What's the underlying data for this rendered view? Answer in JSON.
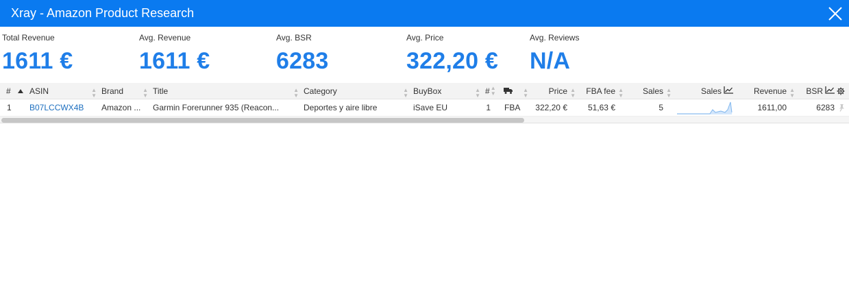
{
  "window": {
    "title": "Xray - Amazon Product Research"
  },
  "stats": [
    {
      "label": "Total Revenue",
      "value": "1611 €"
    },
    {
      "label": "Avg. Revenue",
      "value": "1611 €"
    },
    {
      "label": "Avg. BSR",
      "value": "6283"
    },
    {
      "label": "Avg. Price",
      "value": "322,20 €"
    },
    {
      "label": "Avg. Reviews",
      "value": "N/A"
    }
  ],
  "table": {
    "headers": {
      "index": "#",
      "asin": "ASIN",
      "brand": "Brand",
      "title": "Title",
      "category": "Category",
      "buybox": "BuyBox",
      "sellers": "#",
      "price": "Price",
      "fba_fee": "FBA fee",
      "sales": "Sales",
      "sales_chart": "Sales",
      "revenue": "Revenue",
      "bsr": "BSR"
    },
    "rows": [
      {
        "index": "1",
        "asin": "B07LCCWX4B",
        "brand": "Amazon ...",
        "title": "Garmin Forerunner 935 (Reacon...",
        "category": "Deportes y aire libre",
        "buybox": "iSave EU",
        "sellers": "1",
        "fulfillment": "FBA",
        "price": "322,20 €",
        "fba_fee": "51,63 €",
        "sales": "5",
        "revenue": "1611,00",
        "bsr": "6283"
      }
    ]
  },
  "colors": {
    "titlebar": "#0a7af0",
    "stat_value": "#1f7ee8",
    "link": "#1d6fbf"
  },
  "icons": [
    "close-icon",
    "sort-icon",
    "truck-icon",
    "chart-icon",
    "gear-icon",
    "pin-icon"
  ]
}
